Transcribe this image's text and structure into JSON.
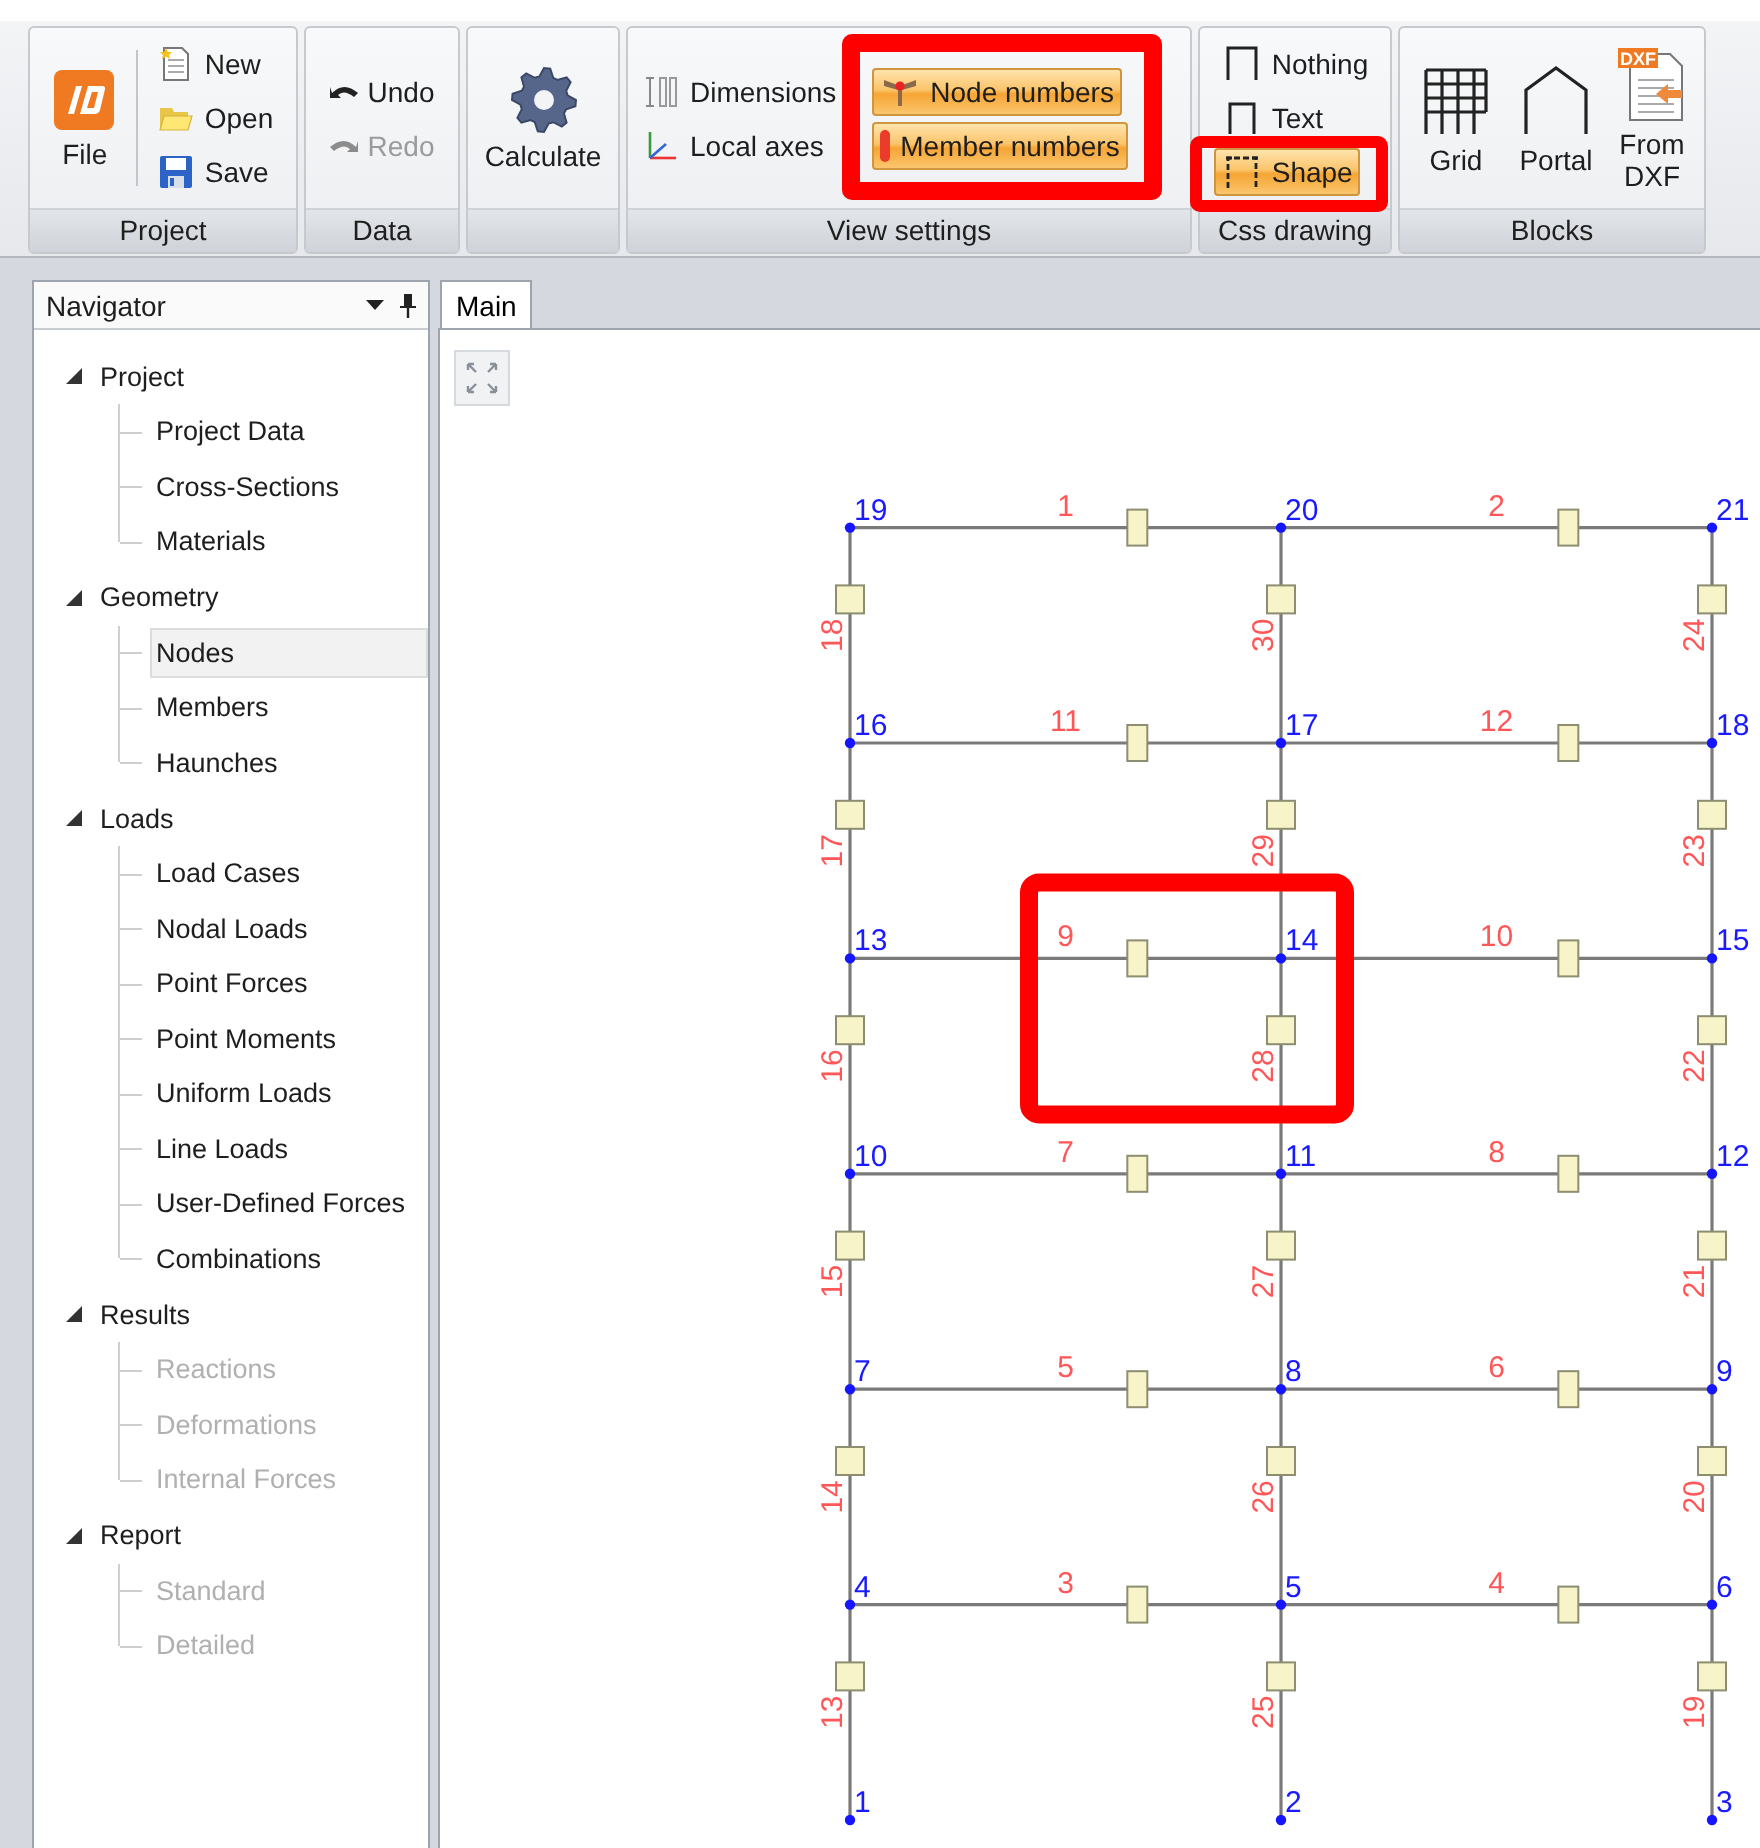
{
  "ribbon": {
    "groups": [
      {
        "label": "Project",
        "stacks": [
          {
            "items": [
              {
                "kind": "large",
                "label": "File"
              }
            ]
          },
          {
            "items": [
              {
                "kind": "small",
                "label": "New"
              },
              {
                "kind": "small",
                "label": "Open"
              },
              {
                "kind": "small",
                "label": "Save"
              }
            ]
          }
        ]
      },
      {
        "label": "Data",
        "stacks": [
          {
            "items": [
              {
                "kind": "small",
                "label": "Undo",
                "disabled": false
              },
              {
                "kind": "small",
                "label": "Redo",
                "disabled": true
              }
            ]
          }
        ]
      },
      {
        "stacks": [
          {
            "items": [
              {
                "kind": "large",
                "label": "Calculate"
              }
            ]
          }
        ]
      },
      {
        "label": "View settings",
        "stacks": [
          {
            "items": [
              {
                "kind": "toggle",
                "label": "Dimensions",
                "on": false
              },
              {
                "kind": "toggle",
                "label": "Local axes",
                "on": false
              }
            ]
          },
          {
            "items": [
              {
                "kind": "toggle",
                "label": "Node numbers",
                "on": true,
                "highlighted": true
              },
              {
                "kind": "toggle",
                "label": "Member numbers",
                "on": true,
                "highlighted": true
              }
            ]
          }
        ]
      },
      {
        "label": "Css drawing",
        "stacks": [
          {
            "items": [
              {
                "kind": "toggle",
                "label": "Nothing",
                "on": false
              },
              {
                "kind": "toggle",
                "label": "Text",
                "on": false
              },
              {
                "kind": "toggle",
                "label": "Shape",
                "on": true,
                "highlighted": true
              }
            ]
          }
        ]
      },
      {
        "label": "Blocks",
        "stacks": [
          {
            "items": [
              {
                "kind": "large",
                "label": "Grid"
              }
            ]
          },
          {
            "items": [
              {
                "kind": "large",
                "label": "Portal"
              }
            ]
          },
          {
            "items": [
              {
                "kind": "large",
                "label": "From DXF",
                "badge": "DXF"
              }
            ]
          }
        ]
      }
    ]
  },
  "navigator": {
    "title": "Navigator",
    "items": [
      {
        "label": "Project",
        "expanded": true,
        "children": [
          {
            "label": "Project Data",
            "selected": false,
            "disabled": false
          },
          {
            "label": "Cross-Sections",
            "selected": false,
            "disabled": false
          },
          {
            "label": "Materials",
            "selected": false,
            "disabled": false
          }
        ]
      },
      {
        "label": "Geometry",
        "expanded": true,
        "children": [
          {
            "label": "Nodes",
            "selected": true,
            "disabled": false
          },
          {
            "label": "Members",
            "selected": false,
            "disabled": false
          },
          {
            "label": "Haunches",
            "selected": false,
            "disabled": false
          }
        ]
      },
      {
        "label": "Loads",
        "expanded": true,
        "children": [
          {
            "label": "Load Cases",
            "selected": false,
            "disabled": false
          },
          {
            "label": "Nodal Loads",
            "selected": false,
            "disabled": false
          },
          {
            "label": "Point Forces",
            "selected": false,
            "disabled": false
          },
          {
            "label": "Point Moments",
            "selected": false,
            "disabled": false
          },
          {
            "label": "Uniform Loads",
            "selected": false,
            "disabled": false
          },
          {
            "label": "Line Loads",
            "selected": false,
            "disabled": false
          },
          {
            "label": "User-Defined Forces",
            "selected": false,
            "disabled": false
          },
          {
            "label": "Combinations",
            "selected": false,
            "disabled": false
          }
        ]
      },
      {
        "label": "Results",
        "expanded": true,
        "children": [
          {
            "label": "Reactions",
            "selected": false,
            "disabled": true
          },
          {
            "label": "Deformations",
            "selected": false,
            "disabled": true
          },
          {
            "label": "Internal Forces",
            "selected": false,
            "disabled": true
          }
        ]
      },
      {
        "label": "Report",
        "expanded": true,
        "children": [
          {
            "label": "Standard",
            "selected": false,
            "disabled": true
          },
          {
            "label": "Detailed",
            "selected": false,
            "disabled": true
          }
        ]
      }
    ]
  },
  "main": {
    "tabs": [
      {
        "label": "Main",
        "selected": true
      }
    ],
    "frame": {
      "storeys": [
        {
          "nodes": [
            {
              "label": "19"
            },
            {
              "label": "20"
            },
            {
              "label": "21"
            }
          ],
          "beams": [
            {
              "label": "1"
            },
            {
              "label": "2"
            }
          ],
          "columns_below": [
            {
              "label": "18"
            },
            {
              "label": "30"
            },
            {
              "label": "24"
            }
          ]
        },
        {
          "nodes": [
            {
              "label": "16"
            },
            {
              "label": "17"
            },
            {
              "label": "18"
            }
          ],
          "beams": [
            {
              "label": "11"
            },
            {
              "label": "12"
            }
          ],
          "columns_below": [
            {
              "label": "17"
            },
            {
              "label": "29"
            },
            {
              "label": "23"
            }
          ]
        },
        {
          "nodes": [
            {
              "label": "13"
            },
            {
              "label": "14",
              "highlighted": true
            },
            {
              "label": "15"
            }
          ],
          "beams": [
            {
              "label": "9"
            },
            {
              "label": "10"
            }
          ],
          "columns_below": [
            {
              "label": "16"
            },
            {
              "label": "28"
            },
            {
              "label": "22"
            }
          ]
        },
        {
          "nodes": [
            {
              "label": "10"
            },
            {
              "label": "11"
            },
            {
              "label": "12"
            }
          ],
          "beams": [
            {
              "label": "7"
            },
            {
              "label": "8"
            }
          ],
          "columns_below": [
            {
              "label": "15"
            },
            {
              "label": "27"
            },
            {
              "label": "21"
            }
          ]
        },
        {
          "nodes": [
            {
              "label": "7"
            },
            {
              "label": "8"
            },
            {
              "label": "9"
            }
          ],
          "beams": [
            {
              "label": "5"
            },
            {
              "label": "6"
            }
          ],
          "columns_below": [
            {
              "label": "14"
            },
            {
              "label": "26"
            },
            {
              "label": "20"
            }
          ]
        },
        {
          "nodes": [
            {
              "label": "4"
            },
            {
              "label": "5"
            },
            {
              "label": "6"
            }
          ],
          "beams": [
            {
              "label": "3"
            },
            {
              "label": "4"
            }
          ],
          "columns_below": [
            {
              "label": "13"
            },
            {
              "label": "25"
            },
            {
              "label": "19"
            }
          ]
        },
        {
          "nodes": [
            {
              "label": "1"
            },
            {
              "label": "2"
            },
            {
              "label": "3"
            }
          ]
        }
      ]
    }
  }
}
